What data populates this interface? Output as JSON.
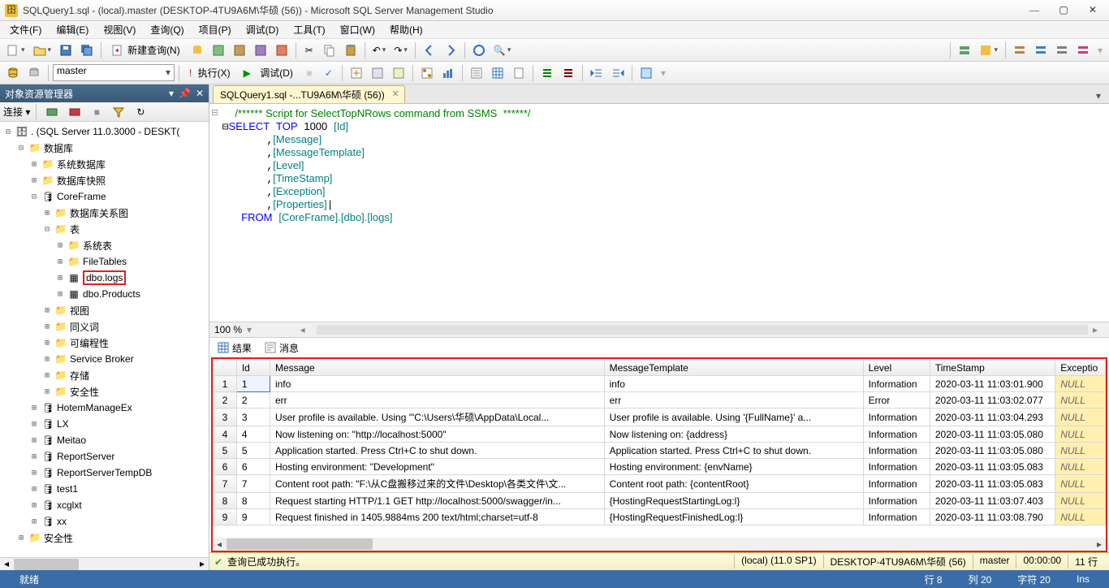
{
  "title": "SQLQuery1.sql - (local).master (DESKTOP-4TU9A6M\\华硕 (56)) - Microsoft SQL Server Management Studio",
  "menus": [
    "文件(F)",
    "编辑(E)",
    "视图(V)",
    "查询(Q)",
    "项目(P)",
    "调试(D)",
    "工具(T)",
    "窗口(W)",
    "帮助(H)"
  ],
  "toolbar1": {
    "new_query": "新建查询(N)"
  },
  "toolbar2": {
    "db_select": "master",
    "execute": "执行(X)",
    "debug": "调试(D)"
  },
  "object_explorer": {
    "title": "对象资源管理器",
    "connect": "连接",
    "root": ". (SQL Server 11.0.3000 - DESKT(",
    "nodes": {
      "databases": "数据库",
      "sys_db": "系统数据库",
      "db_snapshot": "数据库快照",
      "coreframe": "CoreFrame",
      "db_diagram": "数据库关系图",
      "tables": "表",
      "sys_tables": "系统表",
      "filetables": "FileTables",
      "dbo_logs": "dbo.logs",
      "dbo_products": "dbo.Products",
      "views": "视图",
      "synonyms": "同义词",
      "programmability": "可编程性",
      "service_broker": "Service Broker",
      "storage": "存储",
      "security": "安全性",
      "hotem": "HotemManageEx",
      "lx": "LX",
      "meitao": "Meitao",
      "reportserver": "ReportServer",
      "reportservertemp": "ReportServerTempDB",
      "test1": "test1",
      "xcglxt": "xcglxt",
      "xx": "xx",
      "security2": "安全性"
    }
  },
  "doc_tab": "SQLQuery1.sql -...TU9A6M\\华硕 (56))",
  "sql": {
    "comment": "/****** Script for SelectTopNRows command from SSMS  ******/",
    "line1a": "SELECT",
    "line1b": "TOP",
    "line1c": "1000",
    "col_id": "[Id]",
    "cols": [
      "[Message]",
      "[MessageTemplate]",
      "[Level]",
      "[TimeStamp]",
      "[Exception]",
      "[Properties]"
    ],
    "from": "FROM",
    "tbl": "[CoreFrame].[dbo].[logs]"
  },
  "zoom": "100 %",
  "result_tabs": {
    "results": "结果",
    "messages": "消息"
  },
  "grid": {
    "headers": [
      "Id",
      "Message",
      "MessageTemplate",
      "Level",
      "TimeStamp",
      "Exceptio"
    ],
    "rows": [
      {
        "n": "1",
        "id": "1",
        "msg": "info",
        "tpl": "info",
        "lvl": "Information",
        "ts": "2020-03-11 11:03:01.900",
        "ex": "NULL"
      },
      {
        "n": "2",
        "id": "2",
        "msg": "err",
        "tpl": "err",
        "lvl": "Error",
        "ts": "2020-03-11 11:03:02.077",
        "ex": "NULL"
      },
      {
        "n": "3",
        "id": "3",
        "msg": "User profile is available. Using '\"C:\\Users\\华硕\\AppData\\Local...",
        "tpl": "User profile is available. Using '{FullName}' a...",
        "lvl": "Information",
        "ts": "2020-03-11 11:03:04.293",
        "ex": "NULL"
      },
      {
        "n": "4",
        "id": "4",
        "msg": "Now listening on: \"http://localhost:5000\"",
        "tpl": "Now listening on: {address}",
        "lvl": "Information",
        "ts": "2020-03-11 11:03:05.080",
        "ex": "NULL"
      },
      {
        "n": "5",
        "id": "5",
        "msg": "Application started. Press Ctrl+C to shut down.",
        "tpl": "Application started. Press Ctrl+C to shut down.",
        "lvl": "Information",
        "ts": "2020-03-11 11:03:05.080",
        "ex": "NULL"
      },
      {
        "n": "6",
        "id": "6",
        "msg": "Hosting environment: \"Development\"",
        "tpl": "Hosting environment: {envName}",
        "lvl": "Information",
        "ts": "2020-03-11 11:03:05.083",
        "ex": "NULL"
      },
      {
        "n": "7",
        "id": "7",
        "msg": "Content root path: \"F:\\从C盘搬移过来的文件\\Desktop\\各类文件\\文...",
        "tpl": "Content root path: {contentRoot}",
        "lvl": "Information",
        "ts": "2020-03-11 11:03:05.083",
        "ex": "NULL"
      },
      {
        "n": "8",
        "id": "8",
        "msg": "Request starting HTTP/1.1 GET http://localhost:5000/swagger/in...",
        "tpl": "{HostingRequestStartingLog:l}",
        "lvl": "Information",
        "ts": "2020-03-11 11:03:07.403",
        "ex": "NULL"
      },
      {
        "n": "9",
        "id": "9",
        "msg": "Request finished in 1405.9884ms 200 text/html;charset=utf-8",
        "tpl": "{HostingRequestFinishedLog:l}",
        "lvl": "Information",
        "ts": "2020-03-11 11:03:08.790",
        "ex": "NULL"
      }
    ]
  },
  "exec_status": {
    "msg": "查询已成功执行。",
    "server": "(local) (11.0 SP1)",
    "user": "DESKTOP-4TU9A6M\\华硕 (56)",
    "db": "master",
    "time": "00:00:00",
    "rows": "11 行"
  },
  "statusbar": {
    "ready": "就绪",
    "line": "行 8",
    "col": "列 20",
    "ch": "字符 20",
    "ins": "Ins"
  }
}
